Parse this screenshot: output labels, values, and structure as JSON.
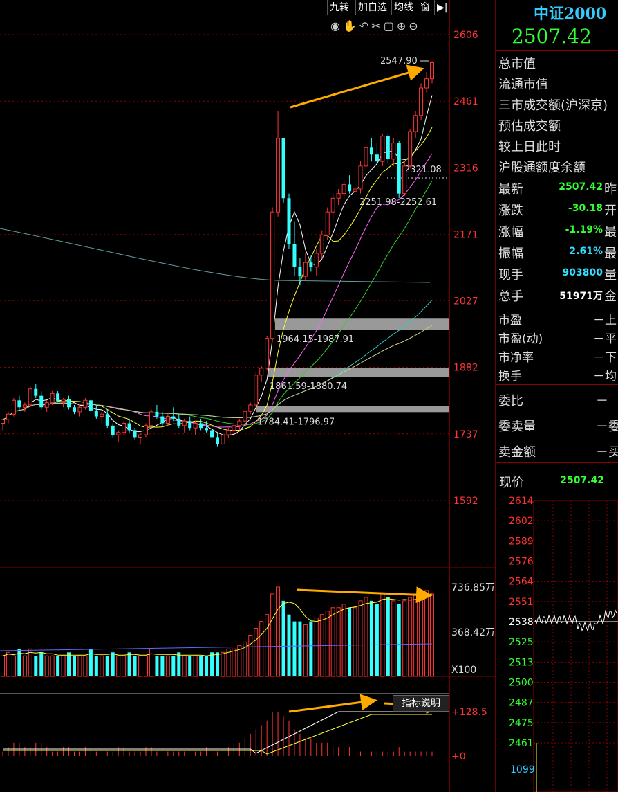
{
  "toolbar": {
    "buttons": [
      "九转",
      "加自选",
      "均线",
      "窗"
    ]
  },
  "index": {
    "name": "中证2000",
    "price": "2507.42"
  },
  "price_axis": [
    "2606",
    "2461",
    "2316",
    "2171",
    "2027",
    "1882",
    "1737",
    "1592"
  ],
  "volume_axis": [
    "736.85万",
    "368.42万"
  ],
  "volume_unit": "X100",
  "macd_axis": [
    "+128.5",
    "+0"
  ],
  "indicator_button": "指标说明",
  "annotations": {
    "peak": "2547.90",
    "level1": "2321.08",
    "level2": "2251.98-2252.61",
    "gap1": "1964.15-1987.91",
    "gap2": "1861.59-1880.74",
    "gap3": "1784.41-1796.97"
  },
  "info_rows": [
    "总市值",
    "流通市值",
    "三市成交额(沪深京)",
    "预估成交额",
    "较上日此时",
    "沪股通额度余额"
  ],
  "quote_rows": [
    {
      "label": "最新",
      "value": "2507.42",
      "color": "#33ff33",
      "tail": "昨"
    },
    {
      "label": "涨跌",
      "value": "-30.18",
      "color": "#33ff33",
      "tail": "开"
    },
    {
      "label": "涨幅",
      "value": "-1.19%",
      "color": "#33ff33",
      "tail": "最"
    },
    {
      "label": "振幅",
      "value": "2.61%",
      "color": "#33ddff",
      "tail": "最"
    },
    {
      "label": "现手",
      "value": "903800",
      "color": "#33ddff",
      "tail": "量"
    },
    {
      "label": "总手",
      "value": "51971万",
      "color": "#ffffff",
      "tail": "金"
    }
  ],
  "stat_rows": [
    {
      "label": "市盈",
      "tail": "－上"
    },
    {
      "label": "市盈(动)",
      "tail": "－平"
    },
    {
      "label": "市净率",
      "tail": "－下"
    },
    {
      "label": "换手",
      "tail": "－均"
    }
  ],
  "order_rows": [
    {
      "label": "委比",
      "tail": "－"
    },
    {
      "label": "委卖量",
      "tail": "－委"
    },
    {
      "label": "卖金额",
      "tail": "－买"
    }
  ],
  "current": {
    "label": "现价",
    "value": "2507.42"
  },
  "intraday_axis": [
    "2614",
    "2602",
    "2589",
    "2576",
    "2564",
    "2551",
    "2538",
    "2525",
    "2513",
    "2500",
    "2487",
    "2475",
    "2461"
  ],
  "intraday_volume": "1099",
  "chart_data": {
    "type": "candlestick",
    "price_ylim": [
      1592,
      2606
    ],
    "candles": [
      [
        1760,
        1770,
        1745,
        1768
      ],
      [
        1768,
        1785,
        1760,
        1780
      ],
      [
        1780,
        1815,
        1775,
        1810
      ],
      [
        1810,
        1820,
        1790,
        1795
      ],
      [
        1795,
        1805,
        1785,
        1800
      ],
      [
        1800,
        1840,
        1795,
        1835
      ],
      [
        1835,
        1845,
        1815,
        1820
      ],
      [
        1820,
        1830,
        1790,
        1795
      ],
      [
        1795,
        1810,
        1785,
        1805
      ],
      [
        1805,
        1830,
        1800,
        1825
      ],
      [
        1825,
        1830,
        1805,
        1808
      ],
      [
        1808,
        1815,
        1795,
        1812
      ],
      [
        1812,
        1820,
        1790,
        1795
      ],
      [
        1795,
        1800,
        1780,
        1785
      ],
      [
        1785,
        1800,
        1775,
        1795
      ],
      [
        1795,
        1815,
        1790,
        1810
      ],
      [
        1810,
        1812,
        1785,
        1788
      ],
      [
        1788,
        1800,
        1770,
        1775
      ],
      [
        1775,
        1785,
        1760,
        1780
      ],
      [
        1780,
        1790,
        1750,
        1755
      ],
      [
        1755,
        1760,
        1730,
        1735
      ],
      [
        1735,
        1745,
        1720,
        1740
      ],
      [
        1740,
        1765,
        1735,
        1760
      ],
      [
        1760,
        1770,
        1740,
        1745
      ],
      [
        1745,
        1750,
        1725,
        1730
      ],
      [
        1730,
        1740,
        1715,
        1735
      ],
      [
        1735,
        1760,
        1730,
        1755
      ],
      [
        1755,
        1790,
        1750,
        1785
      ],
      [
        1785,
        1800,
        1770,
        1775
      ],
      [
        1775,
        1785,
        1755,
        1760
      ],
      [
        1760,
        1780,
        1755,
        1775
      ],
      [
        1775,
        1795,
        1765,
        1770
      ],
      [
        1770,
        1780,
        1750,
        1755
      ],
      [
        1755,
        1770,
        1740,
        1765
      ],
      [
        1765,
        1775,
        1745,
        1750
      ],
      [
        1750,
        1765,
        1735,
        1760
      ],
      [
        1760,
        1770,
        1745,
        1750
      ],
      [
        1750,
        1765,
        1740,
        1745
      ],
      [
        1745,
        1755,
        1725,
        1730
      ],
      [
        1730,
        1740,
        1710,
        1715
      ],
      [
        1715,
        1740,
        1705,
        1735
      ],
      [
        1735,
        1750,
        1728,
        1745
      ],
      [
        1745,
        1760,
        1740,
        1755
      ],
      [
        1755,
        1770,
        1745,
        1765
      ],
      [
        1765,
        1790,
        1760,
        1786
      ],
      [
        1786,
        1805,
        1780,
        1800
      ],
      [
        1800,
        1870,
        1795,
        1865
      ],
      [
        1865,
        1885,
        1850,
        1880
      ],
      [
        1880,
        1950,
        1875,
        1945
      ],
      [
        1945,
        2230,
        1940,
        2220
      ],
      [
        2220,
        2440,
        2210,
        2380
      ],
      [
        2380,
        2290,
        2240,
        2250
      ],
      [
        2250,
        2260,
        2140,
        2150
      ],
      [
        2150,
        2200,
        2080,
        2100
      ],
      [
        2100,
        2120,
        2060,
        2080
      ],
      [
        2080,
        2130,
        2070,
        2110
      ],
      [
        2110,
        2125,
        2090,
        2100
      ],
      [
        2100,
        2140,
        2080,
        2130
      ],
      [
        2130,
        2180,
        2120,
        2170
      ],
      [
        2170,
        2230,
        2160,
        2220
      ],
      [
        2220,
        2260,
        2205,
        2250
      ],
      [
        2250,
        2270,
        2235,
        2260
      ],
      [
        2260,
        2290,
        2245,
        2280
      ],
      [
        2280,
        2300,
        2260,
        2265
      ],
      [
        2265,
        2280,
        2240,
        2270
      ],
      [
        2270,
        2330,
        2260,
        2320
      ],
      [
        2320,
        2370,
        2310,
        2360
      ],
      [
        2360,
        2380,
        2330,
        2345
      ],
      [
        2345,
        2370,
        2320,
        2330
      ],
      [
        2330,
        2390,
        2320,
        2385
      ],
      [
        2385,
        2390,
        2325,
        2335
      ],
      [
        2335,
        2380,
        2320,
        2370
      ],
      [
        2370,
        2375,
        2250,
        2260
      ],
      [
        2260,
        2330,
        2255,
        2320
      ],
      [
        2320,
        2400,
        2315,
        2395
      ],
      [
        2395,
        2440,
        2380,
        2430
      ],
      [
        2430,
        2500,
        2420,
        2490
      ],
      [
        2490,
        2525,
        2480,
        2510
      ],
      [
        2510,
        2548,
        2500,
        2545
      ]
    ],
    "volume": [
      3,
      3.5,
      3,
      4,
      3,
      4,
      3,
      3.5,
      3,
      3,
      3,
      3,
      3.5,
      3,
      3,
      3,
      4,
      3,
      3,
      3,
      3.5,
      3,
      3,
      3.5,
      3,
      3,
      3,
      4,
      3,
      3,
      3,
      3,
      3.5,
      3,
      3,
      3,
      3,
      3,
      3.5,
      3.5,
      3.5,
      4,
      4,
      4.5,
      5,
      6,
      7,
      8,
      9,
      12,
      13,
      11,
      9,
      8,
      8,
      7.5,
      8,
      8.5,
      9,
      9.5,
      10,
      10,
      10.5,
      10,
      10,
      11,
      11.5,
      11,
      10.5,
      12,
      11.5,
      11,
      10.5,
      11,
      11.5,
      12,
      12,
      12.5,
      12
    ],
    "macd_hist": [
      0.1,
      0.2,
      0.3,
      0.3,
      0.2,
      0.2,
      0.3,
      0.3,
      0.2,
      0.1,
      0.1,
      0.2,
      0.2,
      0.1,
      0.1,
      0.2,
      0.2,
      0.1,
      0,
      0.1,
      0.1,
      0.2,
      0.2,
      0.1,
      0.1,
      0.1,
      0.2,
      0.2,
      0.1,
      0,
      0.1,
      0.1,
      0.1,
      0.1,
      0,
      0.1,
      0.1,
      0.2,
      0.1,
      0.1,
      0.1,
      0.2,
      0.3,
      0.3,
      0.4,
      0.5,
      0.6,
      0.7,
      0.8,
      1.0,
      1.0,
      0.9,
      0.8,
      0.6,
      0.5,
      0.4,
      0.4,
      0.3,
      0.3,
      0.3,
      0.2,
      0.2,
      0.2,
      0.2,
      0.1,
      0.1,
      0.1,
      0.1,
      0.1,
      0.1,
      0.1,
      0.1,
      0.2,
      0.1,
      0.1,
      0.1,
      0.1,
      0.1,
      0.1
    ]
  }
}
